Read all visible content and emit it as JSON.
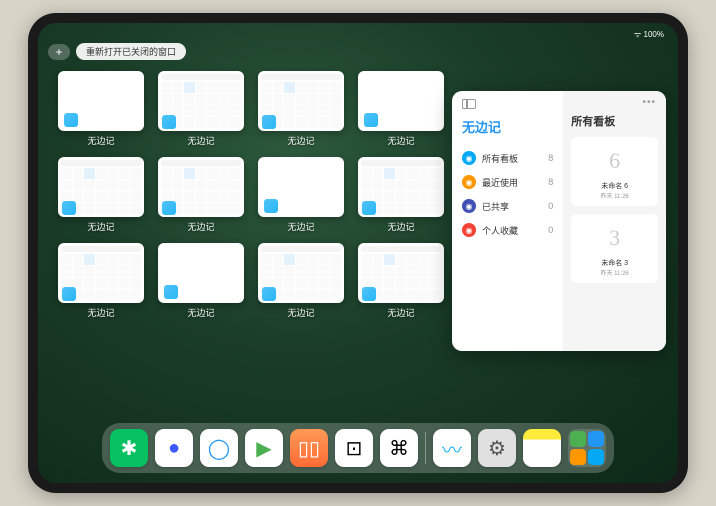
{
  "status": {
    "battery": "100%",
    "signal": "wifi-icon"
  },
  "top": {
    "plus": "+",
    "reopen_label": "重新打开已关闭的窗口"
  },
  "apps": [
    {
      "label": "无边记",
      "type": "blank"
    },
    {
      "label": "无边记",
      "type": "calendar"
    },
    {
      "label": "无边记",
      "type": "calendar"
    },
    {
      "label": "无边记",
      "type": "blank"
    },
    {
      "label": "无边记",
      "type": "calendar"
    },
    {
      "label": "无边记",
      "type": "calendar"
    },
    {
      "label": "无边记",
      "type": "blank"
    },
    {
      "label": "无边记",
      "type": "calendar"
    },
    {
      "label": "无边记",
      "type": "calendar"
    },
    {
      "label": "无边记",
      "type": "blank"
    },
    {
      "label": "无边记",
      "type": "calendar"
    },
    {
      "label": "无边记",
      "type": "calendar"
    }
  ],
  "panel": {
    "title": "无边记",
    "right_title": "所有看板",
    "items": [
      {
        "label": "所有看板",
        "count": "8",
        "color": "#03a9f4"
      },
      {
        "label": "最近使用",
        "count": "8",
        "color": "#ff9800"
      },
      {
        "label": "已共享",
        "count": "0",
        "color": "#3f51b5"
      },
      {
        "label": "个人收藏",
        "count": "0",
        "color": "#f44336"
      }
    ],
    "boards": [
      {
        "glyph": "6",
        "name": "未命名 6",
        "date": "昨天 11:26"
      },
      {
        "glyph": "3",
        "name": "未命名 3",
        "date": "昨天 11:26"
      }
    ]
  },
  "dock": [
    {
      "name": "wechat",
      "bg": "#07c160",
      "glyph": "✱"
    },
    {
      "name": "app-blue-dot",
      "bg": "#ffffff",
      "glyph": "●",
      "fg": "#3d5afe"
    },
    {
      "name": "qq-browser",
      "bg": "#ffffff",
      "glyph": "◯",
      "fg": "#2196f3"
    },
    {
      "name": "play",
      "bg": "#ffffff",
      "glyph": "▶",
      "fg": "#4caf50"
    },
    {
      "name": "books",
      "bg": "linear-gradient(#ff9a56,#ff6b35)",
      "glyph": "▯▯",
      "fg": "#fff"
    },
    {
      "name": "dice",
      "bg": "#ffffff",
      "glyph": "⊡",
      "fg": "#000"
    },
    {
      "name": "nodes",
      "bg": "#ffffff",
      "glyph": "⌘",
      "fg": "#000"
    },
    {
      "name": "sep"
    },
    {
      "name": "freeform",
      "bg": "#ffffff",
      "glyph": "〰",
      "fg": "#29b6f6"
    },
    {
      "name": "settings",
      "bg": "#e0e0e0",
      "glyph": "⚙",
      "fg": "#555"
    },
    {
      "name": "notes",
      "bg": "linear-gradient(#ffeb3b 28%,#fff 28%)",
      "glyph": "",
      "fg": "#000"
    },
    {
      "name": "cluster"
    }
  ]
}
